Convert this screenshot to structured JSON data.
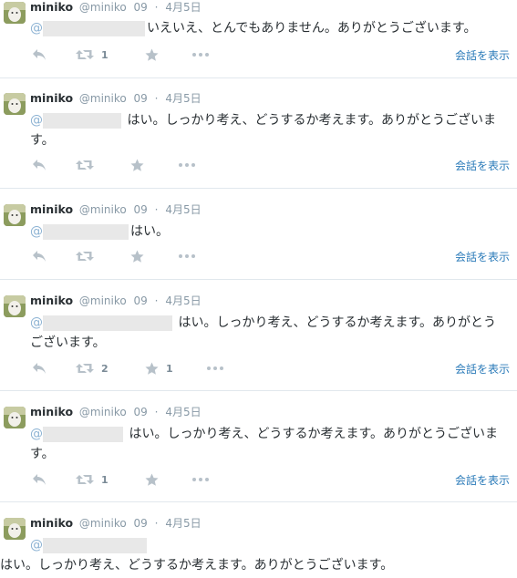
{
  "colors": {
    "name": "#292f33",
    "meta": "#8899a6",
    "mention": "#8cb2d3",
    "action_icon": "#b7c1c9",
    "link": "#2b7bb9"
  },
  "icons": {
    "reply": "reply-icon",
    "retweet": "retweet-icon",
    "favorite": "star-icon",
    "more": "more-icon"
  },
  "tweets": [
    {
      "fullname": "miniko",
      "screenname": "@miniko",
      "time_num": "09",
      "dot": "·",
      "date": "4月5日",
      "at": "@",
      "text": "いえいえ、とんでもありません。ありがとうございます。",
      "retweet_count": "1",
      "favorite_count": "",
      "expand": "会話を表示"
    },
    {
      "fullname": "miniko",
      "screenname": "@miniko",
      "time_num": "09",
      "dot": "·",
      "date": "4月5日",
      "at": "@",
      "text": "はい。しっかり考え、どうするか考えます。ありがとうございます。",
      "retweet_count": "",
      "favorite_count": "",
      "expand": "会話を表示"
    },
    {
      "fullname": "miniko",
      "screenname": "@miniko",
      "time_num": "09",
      "dot": "·",
      "date": "4月5日",
      "at": "@",
      "text": "はい。",
      "retweet_count": "",
      "favorite_count": "",
      "expand": "会話を表示"
    },
    {
      "fullname": "miniko",
      "screenname": "@miniko",
      "time_num": "09",
      "dot": "·",
      "date": "4月5日",
      "at": "@",
      "text": "はい。しっかり考え、どうするか考えます。ありがとうございます。",
      "retweet_count": "2",
      "favorite_count": "1",
      "expand": "会話を表示"
    },
    {
      "fullname": "miniko",
      "screenname": "@miniko",
      "time_num": "09",
      "dot": "·",
      "date": "4月5日",
      "at": "@",
      "text": "はい。しっかり考え、どうするか考えます。ありがとうございます。",
      "retweet_count": "1",
      "favorite_count": "",
      "expand": "会話を表示"
    },
    {
      "fullname": "miniko",
      "screenname": "@miniko",
      "time_num": "09",
      "dot": "·",
      "date": "4月5日",
      "at": "@",
      "text": "はい。しっかり考え、どうするか考えます。ありがとうございます。"
    }
  ]
}
